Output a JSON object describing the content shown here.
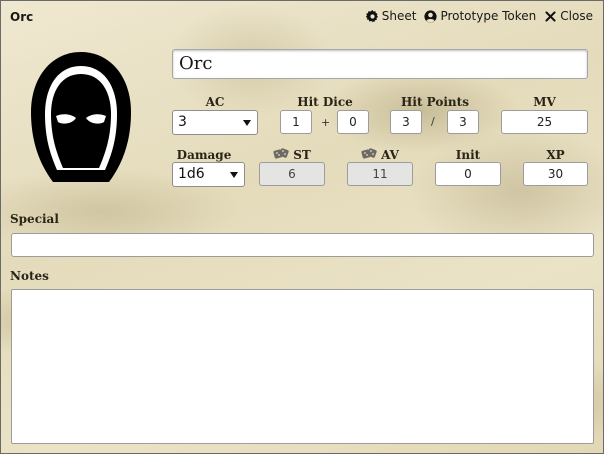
{
  "window": {
    "title": "Orc",
    "actions": {
      "sheet": "Sheet",
      "prototype_token": "Prototype Token",
      "close": "Close"
    }
  },
  "portrait": {
    "icon": "hooded-figure-icon"
  },
  "actor": {
    "name": "Orc"
  },
  "stats": {
    "ac": {
      "label": "AC",
      "value": "3"
    },
    "hit_dice": {
      "label": "Hit Dice",
      "count": "1",
      "plus_sign": "+",
      "bonus": "0"
    },
    "hit_points": {
      "label": "Hit Points",
      "current": "3",
      "slash": "/",
      "max": "3"
    },
    "mv": {
      "label": "MV",
      "value": "25"
    },
    "damage": {
      "label": "Damage",
      "value": "1d6"
    },
    "st": {
      "label": "ST",
      "value": "6",
      "icon": "dice-icon"
    },
    "av": {
      "label": "AV",
      "value": "11",
      "icon": "dice-icon"
    },
    "init": {
      "label": "Init",
      "value": "0"
    },
    "xp": {
      "label": "XP",
      "value": "30"
    }
  },
  "special": {
    "label": "Special",
    "value": ""
  },
  "notes": {
    "label": "Notes",
    "value": ""
  }
}
